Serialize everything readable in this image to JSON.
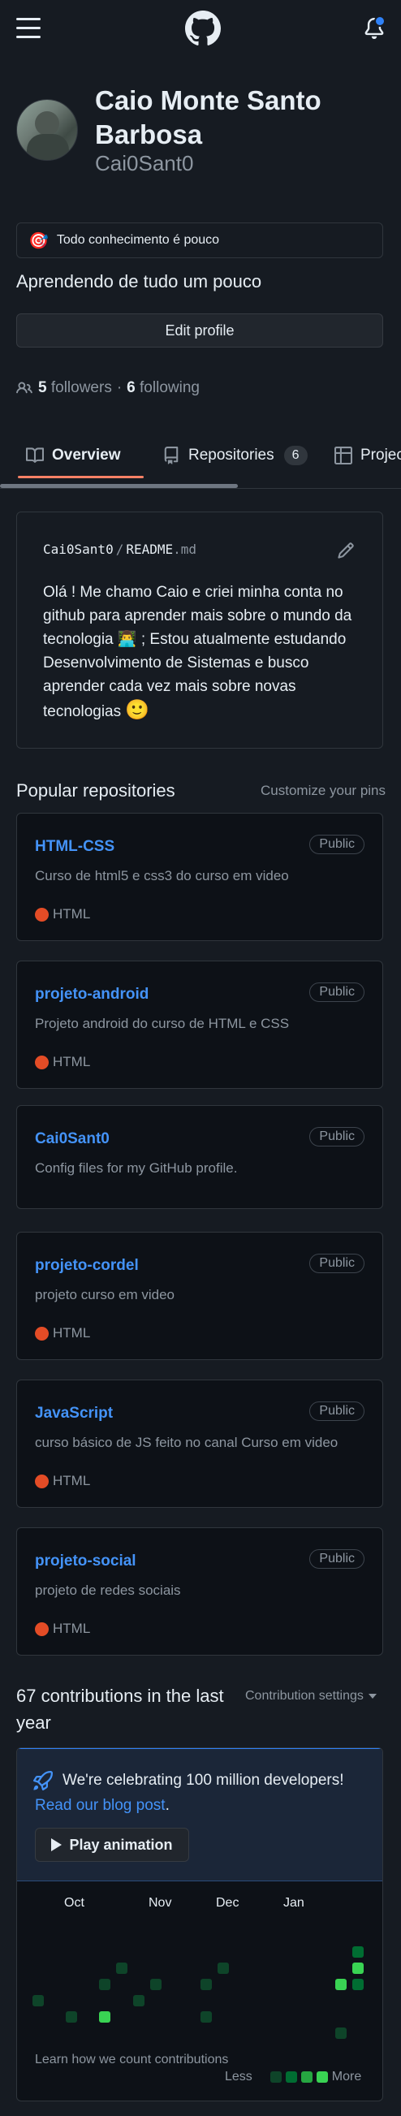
{
  "header": {
    "logo": "github-logo",
    "menu_icon": "hamburger-menu-icon",
    "bell_icon": "bell-icon",
    "notification_color": "#2f81f7"
  },
  "profile": {
    "name_line1": "Caio Monte Santo",
    "name_line2": "Barbosa",
    "username": "Cai0Sant0",
    "status_emoji": "🎯",
    "status_text": "Todo conhecimento é pouco",
    "bio": "Aprendendo de tudo um pouco",
    "edit_button": "Edit profile",
    "followers_count": "5",
    "followers_label": "followers",
    "separator": "·",
    "following_count": "6",
    "following_label": "following"
  },
  "tabs": [
    {
      "label": "Overview",
      "icon": "book-icon",
      "selected": true
    },
    {
      "label": "Repositories",
      "icon": "repo-icon",
      "count": "6"
    },
    {
      "label": "Projects",
      "icon": "table-icon"
    }
  ],
  "readme": {
    "user": "Cai0Sant0",
    "slash": "/",
    "file": "README",
    "ext": ".md",
    "text1": "Olá ! Me chamo Caio e criei minha conta no github para aprender mais sobre o mundo da tecnologia",
    "emoji1": "👨‍💻",
    "text2": " ; Estou atualmente estudando Desenvolvimento de Sistemas e busco aprender cada vez mais sobre novas tecnologias ",
    "emoji2": "🙂"
  },
  "popular": {
    "title": "Popular repositories",
    "customize": "Customize your pins",
    "repos": [
      {
        "name": "HTML-CSS",
        "visibility": "Public",
        "description": "Curso de html5 e css3 do curso em video",
        "language": "HTML"
      },
      {
        "name": "projeto-android",
        "visibility": "Public",
        "description": "Projeto android do curso de HTML e CSS",
        "language": "HTML"
      },
      {
        "name": "Cai0Sant0",
        "visibility": "Public",
        "description": "Config files for my GitHub profile.",
        "language": ""
      },
      {
        "name": "projeto-cordel",
        "visibility": "Public",
        "description": "projeto curso em video",
        "language": "HTML"
      },
      {
        "name": "JavaScript",
        "visibility": "Public",
        "description": "curso básico de JS feito no canal Curso em video",
        "language": "HTML"
      },
      {
        "name": "projeto-social",
        "visibility": "Public",
        "description": "projeto de redes sociais",
        "language": "HTML"
      }
    ],
    "language_color": "#e34c26"
  },
  "contributions": {
    "title_line1": "67 contributions in the last",
    "title_line2": "year",
    "settings": "Contribution settings",
    "banner_text": "We're celebrating 100 million developers!",
    "banner_link": "Read our blog post",
    "banner_period": ".",
    "play_button": "Play animation",
    "months": [
      "Oct",
      "Nov",
      "Dec",
      "Jan"
    ],
    "learn": "Learn how we count contributions",
    "less": "Less",
    "more": "More",
    "level_colors": [
      "#0e4429",
      "#006d32",
      "#26a641",
      "#39d353"
    ]
  }
}
